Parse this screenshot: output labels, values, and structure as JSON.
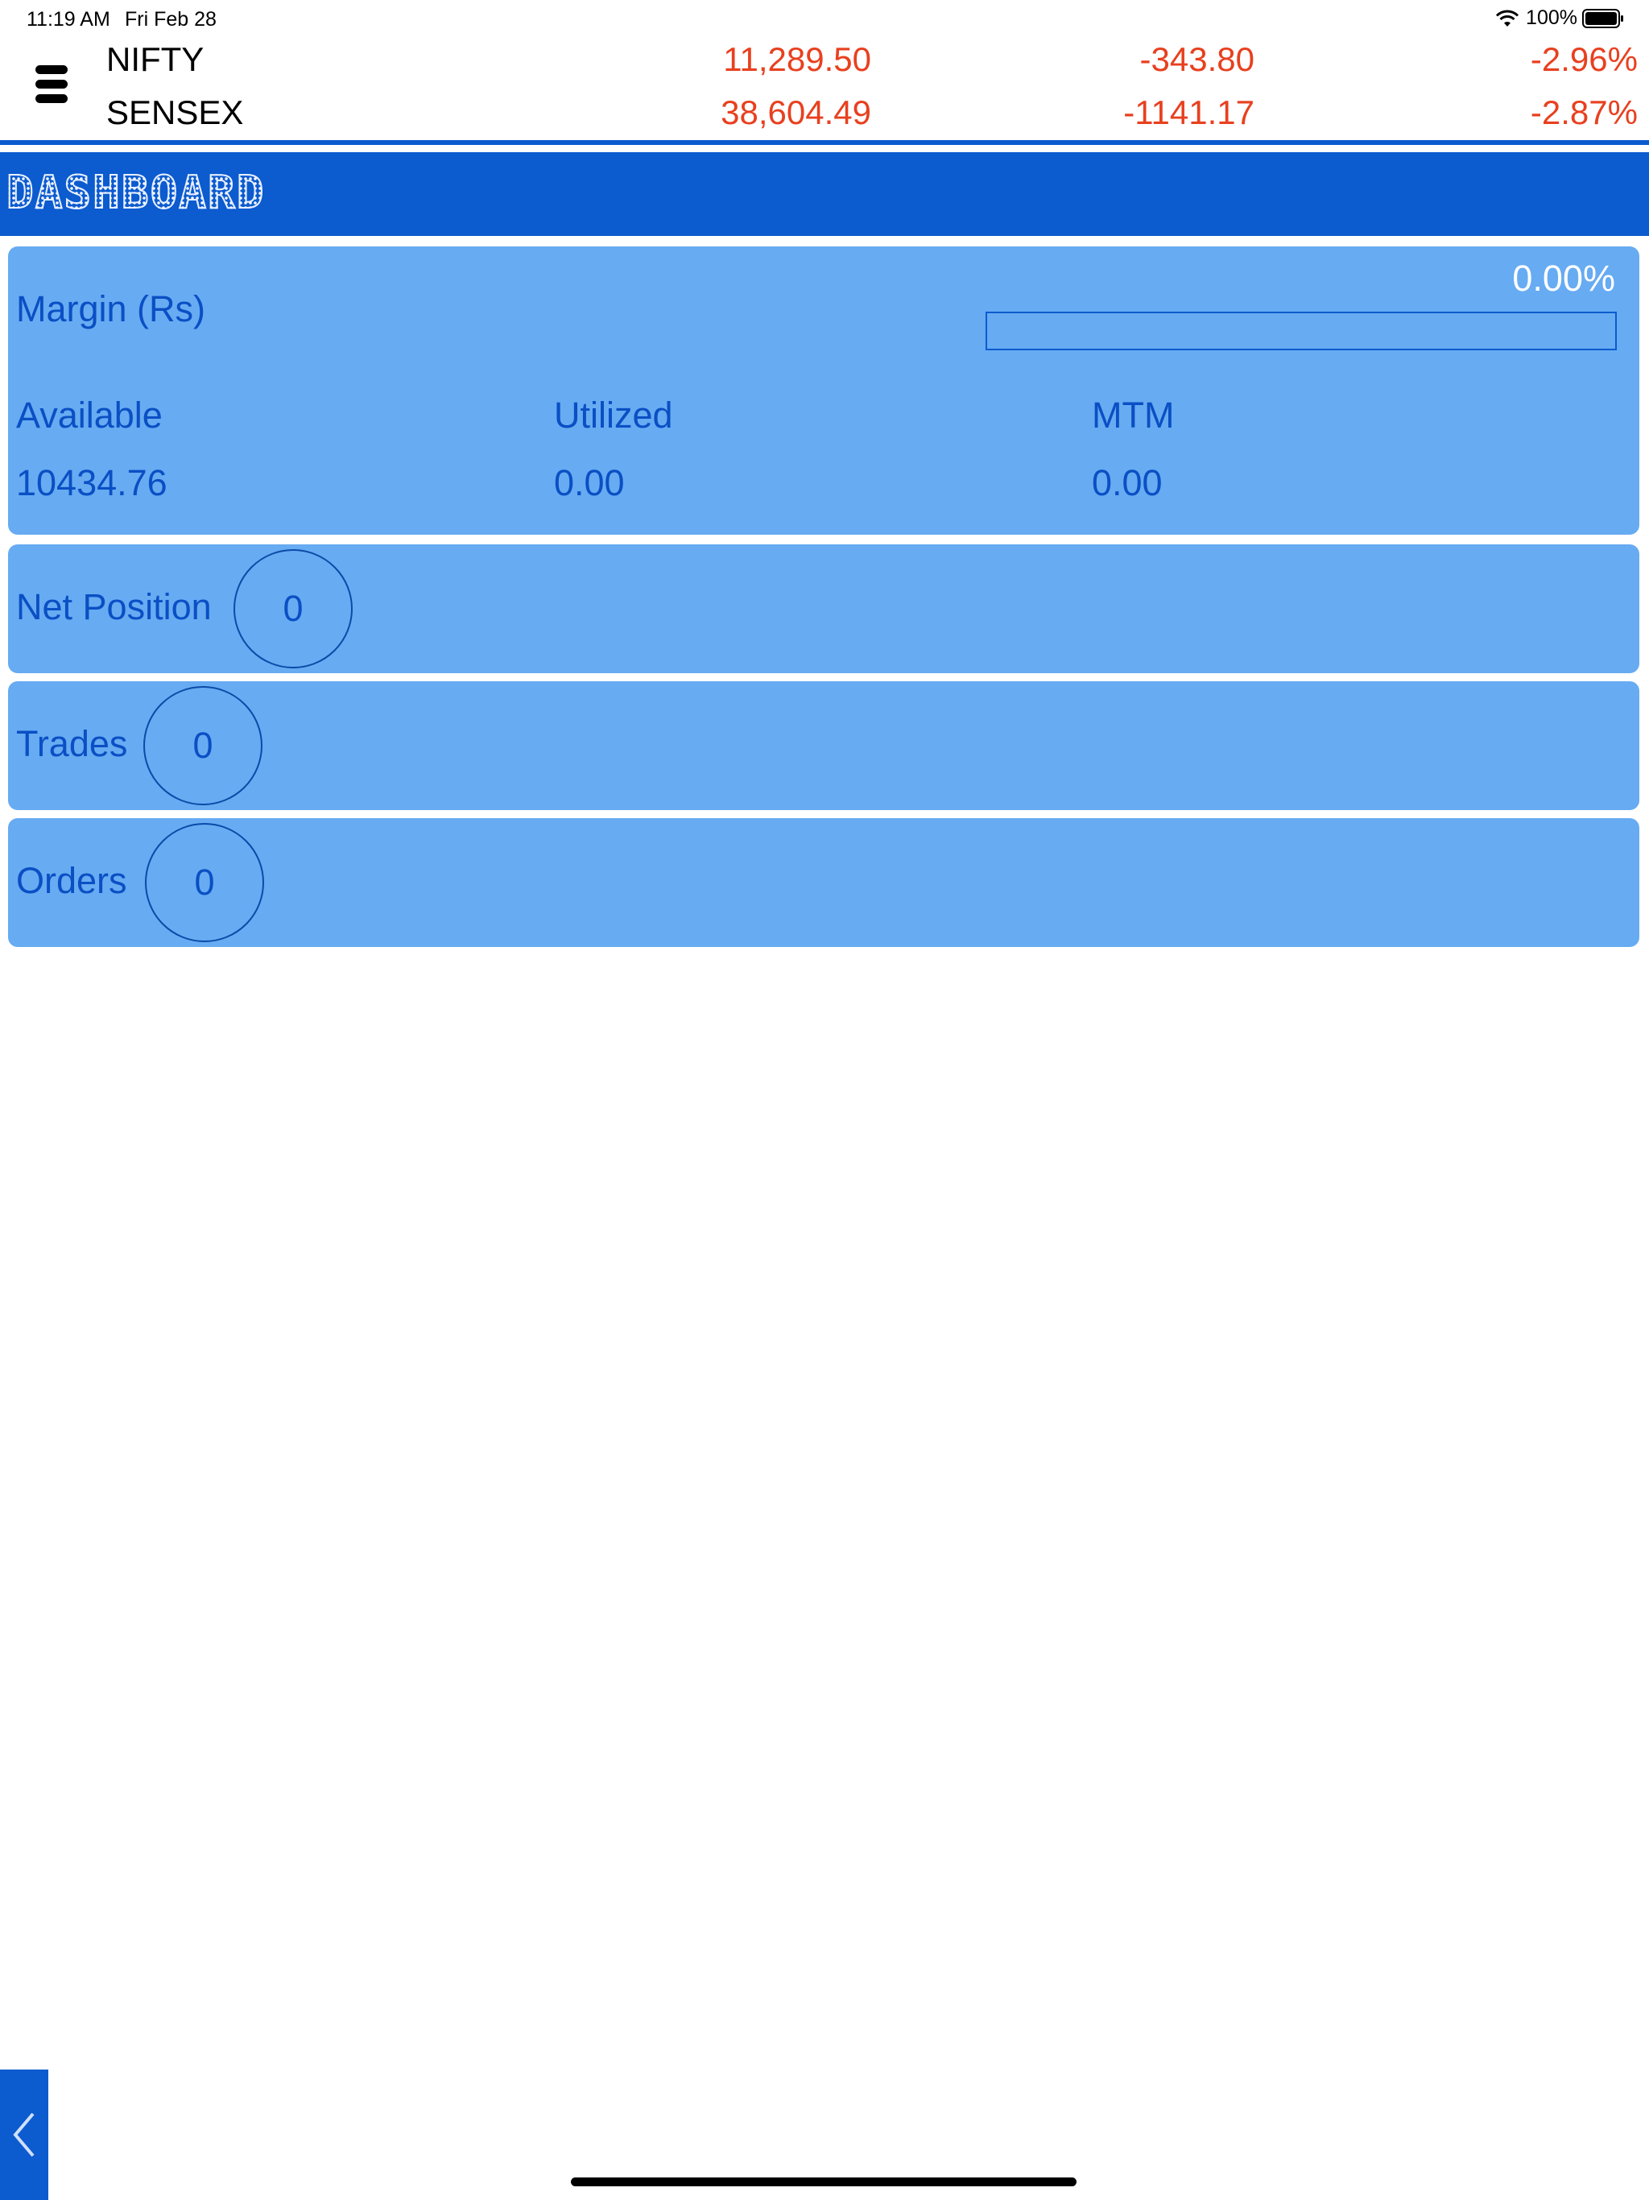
{
  "status_bar": {
    "time": "11:19 AM",
    "date": "Fri Feb 28",
    "battery": "100%"
  },
  "ticker": [
    {
      "name": "NIFTY",
      "value": "11,289.50",
      "change": "-343.80",
      "percent": "-2.96%"
    },
    {
      "name": "SENSEX",
      "value": "38,604.49",
      "change": "-1141.17",
      "percent": "-2.87%"
    }
  ],
  "header": {
    "title": "DASHBOARD"
  },
  "margin": {
    "label": "Margin (Rs)",
    "percent": "0.00%",
    "progress_fraction": 0,
    "columns": [
      {
        "label": "Available",
        "value": "10434.76"
      },
      {
        "label": "Utilized",
        "value": "0.00"
      },
      {
        "label": "MTM",
        "value": "0.00"
      }
    ]
  },
  "net_position": {
    "label": "Net Position",
    "count": "0"
  },
  "trades": {
    "label": "Trades",
    "count": "0"
  },
  "orders": {
    "label": "Orders",
    "count": "0"
  },
  "colors": {
    "accent": "#0c5bcf",
    "card": "#67abf2",
    "card_text": "#0a4fc4",
    "negative": "#e8401f"
  }
}
